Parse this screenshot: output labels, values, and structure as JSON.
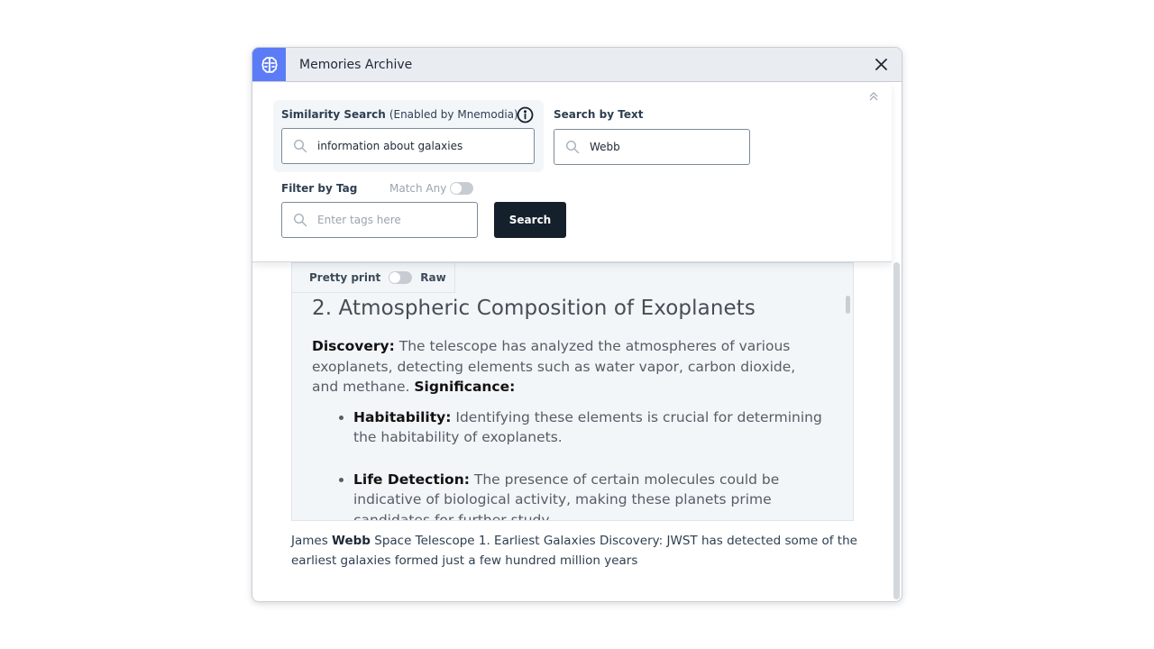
{
  "window": {
    "title": "Memories Archive",
    "app_icon": "brain-icon",
    "close_icon": "close-icon"
  },
  "search_panel": {
    "similarity": {
      "label": "Similarity Search",
      "sublabel": "(Enabled by Mnemodia)",
      "info_icon": "info-icon",
      "value": "information about galaxies"
    },
    "text_search": {
      "label": "Search by Text",
      "value": "Webb"
    },
    "tag_filter": {
      "label": "Filter by Tag",
      "match_any_label": "Match Any",
      "match_any_on": false,
      "placeholder": "Enter tags here"
    },
    "search_button": "Search",
    "collapse_icon": "chevron-double-up-icon"
  },
  "result": {
    "view_toggle": {
      "left_label": "Pretty print",
      "right_label": "Raw",
      "raw_on": false
    },
    "heading": "2. Atmospheric Composition of Exoplanets",
    "discovery_label": "Discovery:",
    "discovery_text": " The telescope has analyzed the atmospheres of various exoplanets, detecting elements such as water vapor, carbon dioxide, and methane. ",
    "significance_label": "Significance:",
    "bullets": [
      {
        "label": "Habitability:",
        "text": " Identifying these elements is crucial for determining the habitability of exoplanets."
      },
      {
        "label": "Life Detection:",
        "text": " The presence of certain molecules could be indicative of biological activity, making these planets prime candidates for further study."
      }
    ],
    "snippet": {
      "before": "James ",
      "highlight": "Webb",
      "after": " Space Telescope 1. Earliest Galaxies Discovery: JWST has detected some of the earliest galaxies formed just a few hundred million years"
    }
  }
}
